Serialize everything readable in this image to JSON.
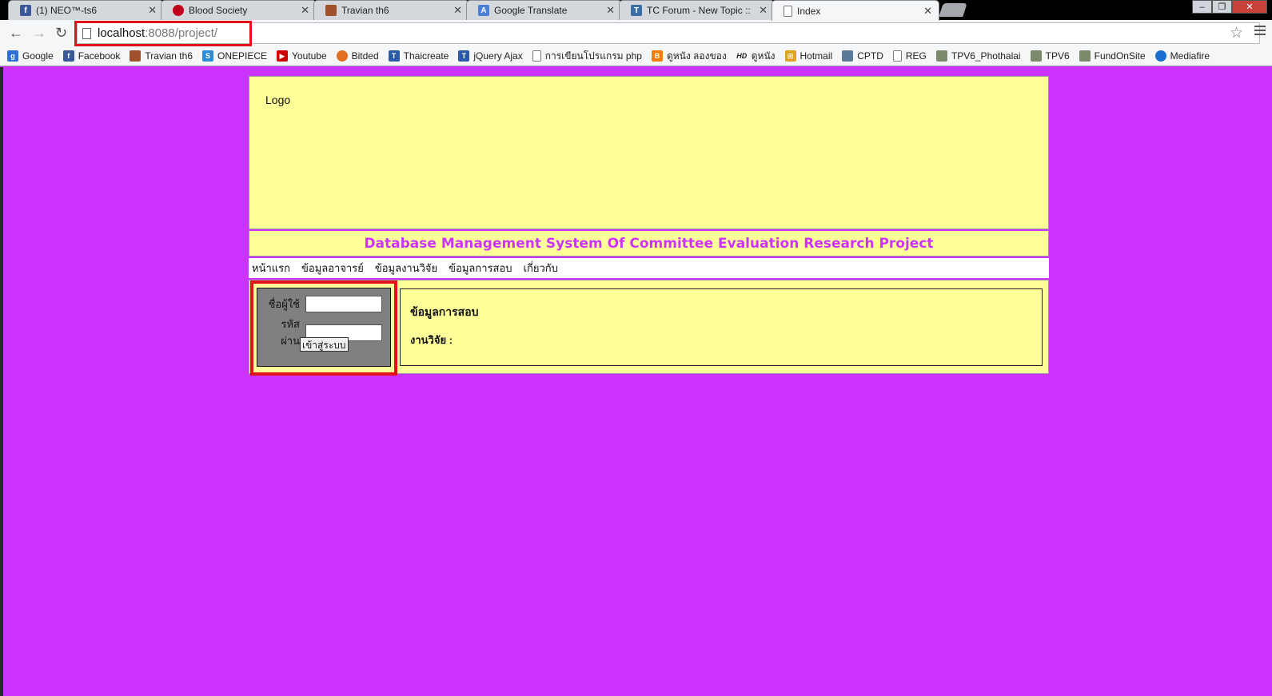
{
  "browser": {
    "tabs": [
      {
        "title": "(1) NEO™-ts6",
        "icon": "facebook-icon",
        "color": "#3b5998"
      },
      {
        "title": "Blood Society",
        "icon": "blood-drop-icon",
        "color": "#c0001a"
      },
      {
        "title": "Travian th6",
        "icon": "travian-icon",
        "color": "#a0522d"
      },
      {
        "title": "Google Translate",
        "icon": "google-translate-icon",
        "color": "#4a7fd6"
      },
      {
        "title": "TC Forum - New Topic :: …",
        "icon": "tc-forum-icon",
        "color": "#3a6ea5"
      },
      {
        "title": "Index",
        "icon": "page-icon",
        "color": "#ffffff"
      }
    ],
    "url_host": "localhost",
    "url_rest": ":8088/project/",
    "bookmarks": [
      {
        "label": "Google",
        "icon": "google-icon",
        "color": "#2f6fd6"
      },
      {
        "label": "Facebook",
        "icon": "facebook-icon",
        "color": "#3b5998"
      },
      {
        "label": "Travian th6",
        "icon": "travian-icon",
        "color": "#a0522d"
      },
      {
        "label": "ONEPIECE",
        "icon": "onepiece-icon",
        "color": "#2e8bd6"
      },
      {
        "label": "Youtube",
        "icon": "youtube-icon",
        "color": "#cc0000"
      },
      {
        "label": "Bitded",
        "icon": "bitded-icon",
        "color": "#e07020"
      },
      {
        "label": "Thaicreate",
        "icon": "thaicreate-icon",
        "color": "#2b5aa8"
      },
      {
        "label": "jQuery Ajax",
        "icon": "jquery-icon",
        "color": "#2b5aa8"
      },
      {
        "label": "การเขียนโปรแกรม php",
        "icon": "page-icon",
        "color": "#ffffff"
      },
      {
        "label": "ดูหนัง ลองของ",
        "icon": "blogger-icon",
        "color": "#f57d00"
      },
      {
        "label": "ดูหนัง",
        "icon": "hd-icon",
        "color": "#222222"
      },
      {
        "label": "Hotmail",
        "icon": "windows-icon",
        "color": "#e0a020"
      },
      {
        "label": "CPTD",
        "icon": "cptd-icon",
        "color": "#5a7a9a"
      },
      {
        "label": "REG",
        "icon": "page-icon",
        "color": "#ffffff"
      },
      {
        "label": "TPV6_Phothalai",
        "icon": "chart-icon",
        "color": "#7a8a6a"
      },
      {
        "label": "TPV6",
        "icon": "chart-icon",
        "color": "#7a8a6a"
      },
      {
        "label": "FundOnSite",
        "icon": "chart-icon",
        "color": "#7a8a6a"
      },
      {
        "label": "Mediafire",
        "icon": "mediafire-icon",
        "color": "#1a6ecf"
      }
    ]
  },
  "page": {
    "logo": "Logo",
    "title": "Database Management System Of Committee Evaluation Research Project",
    "menu": [
      "หน้าแรก",
      "ข้อมูลอาจารย์",
      "ข้อมูลงานวิจัย",
      "ข้อมูลการสอบ",
      "เกี่ยวกับ"
    ],
    "login": {
      "username_label": "ชื่อผู้ใช้",
      "password_label": "รหัสผ่าน",
      "submit_label": "เข้าสู่ระบบ"
    },
    "info": {
      "title": "ข้อมูลการสอบ",
      "research_label": "งานวิจัย :"
    },
    "colors": {
      "background": "#cc33ff",
      "panel": "#ffff99",
      "login_panel": "#808080",
      "highlight": "#e3111c"
    }
  }
}
